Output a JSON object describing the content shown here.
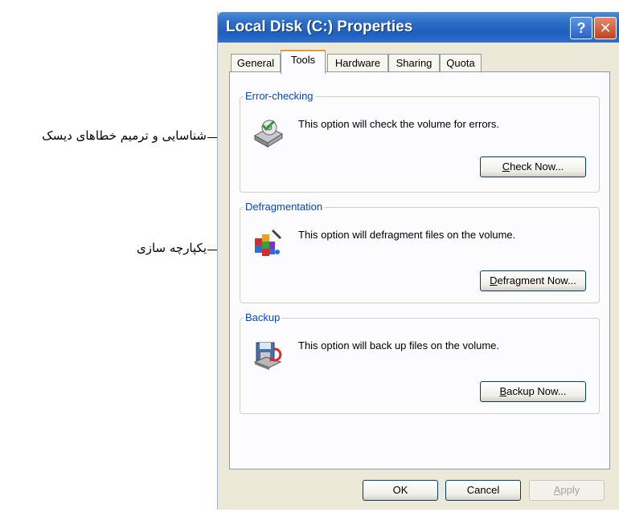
{
  "window": {
    "title": "Local Disk (C:) Properties",
    "help_glyph": "?",
    "close_glyph": "✕"
  },
  "tabs": [
    {
      "label": "General"
    },
    {
      "label": "Tools",
      "active": true
    },
    {
      "label": "Hardware"
    },
    {
      "label": "Sharing"
    },
    {
      "label": "Quota"
    }
  ],
  "groups": {
    "error_checking": {
      "title": "Error-checking",
      "description": "This option will check the volume for errors.",
      "button_mnemonic": "C",
      "button_rest": "heck Now...",
      "icon": "disk-check-icon"
    },
    "defragmentation": {
      "title": "Defragmentation",
      "description": "This option will defragment files on the volume.",
      "button_mnemonic": "D",
      "button_rest": "efragment Now...",
      "icon": "defragment-icon"
    },
    "backup": {
      "title": "Backup",
      "description": "This option will back up files on the volume.",
      "button_mnemonic": "B",
      "button_rest": "ackup Now...",
      "icon": "backup-icon"
    }
  },
  "footer": {
    "ok": "OK",
    "cancel": "Cancel",
    "apply_mnemonic": "A",
    "apply_rest": "pply"
  },
  "annotations": {
    "error_checking": "شناسایی و ترمیم خطاهای دیسک",
    "defragmentation": "یکپارچه سازی"
  },
  "colors": {
    "titlebar": "#2d6cc6",
    "group_title": "#0046d5",
    "dialog_bg": "#ece9d8",
    "active_tab_accent": "#e69a3c"
  }
}
